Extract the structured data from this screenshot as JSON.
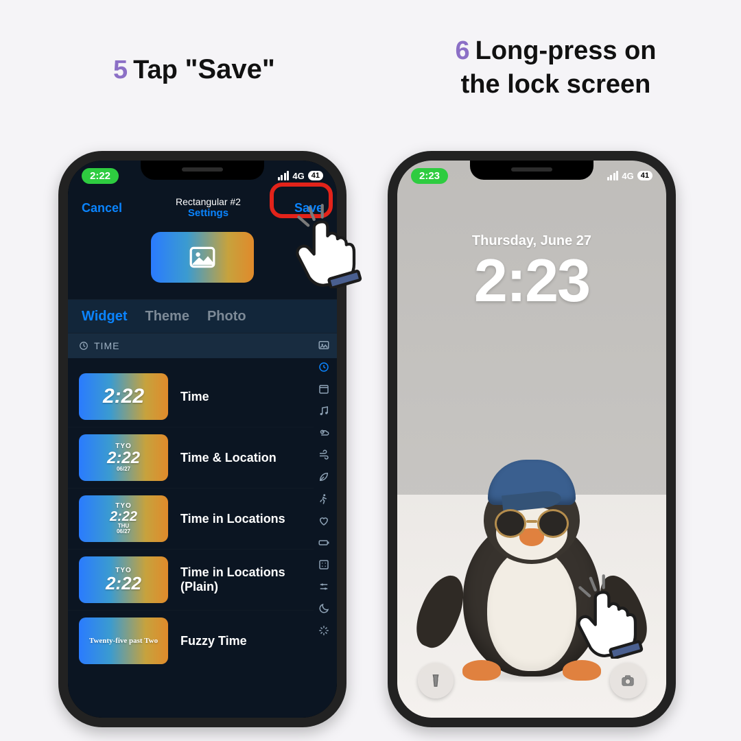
{
  "captions": {
    "step5_num": "5",
    "step5_pre": "Tap ",
    "step5_bold": "\"Save\"",
    "step6_num": "6",
    "step6_line1": "Long-press on",
    "step6_line2": "the lock screen"
  },
  "phone1": {
    "status": {
      "time": "2:22",
      "network": "4G",
      "battery": "41"
    },
    "nav": {
      "cancel": "Cancel",
      "title": "Rectangular #2",
      "subtitle": "Settings",
      "save": "Save"
    },
    "tabs": {
      "widget": "Widget",
      "theme": "Theme",
      "photo": "Photo"
    },
    "section": "TIME",
    "rows": [
      {
        "label": "Time",
        "chip": {
          "big": "2:22"
        }
      },
      {
        "label": "Time & Location",
        "chip": {
          "top": "TYO",
          "big": "2:22",
          "sub": "06/27"
        }
      },
      {
        "label": "Time in Locations",
        "chip": {
          "top": "TYO",
          "big": "2:22",
          "sub": "THU",
          "sub2": "06/27"
        }
      },
      {
        "label": "Time in Locations (Plain)",
        "chip": {
          "top": "TYO",
          "big": "2:22"
        }
      },
      {
        "label": "Fuzzy Time",
        "chip": {
          "fuzzy": "Twenty-five past Two"
        }
      }
    ]
  },
  "phone2": {
    "status": {
      "time": "2:23",
      "network": "4G",
      "battery": "41"
    },
    "date": "Thursday, June 27",
    "time": "2:23"
  }
}
